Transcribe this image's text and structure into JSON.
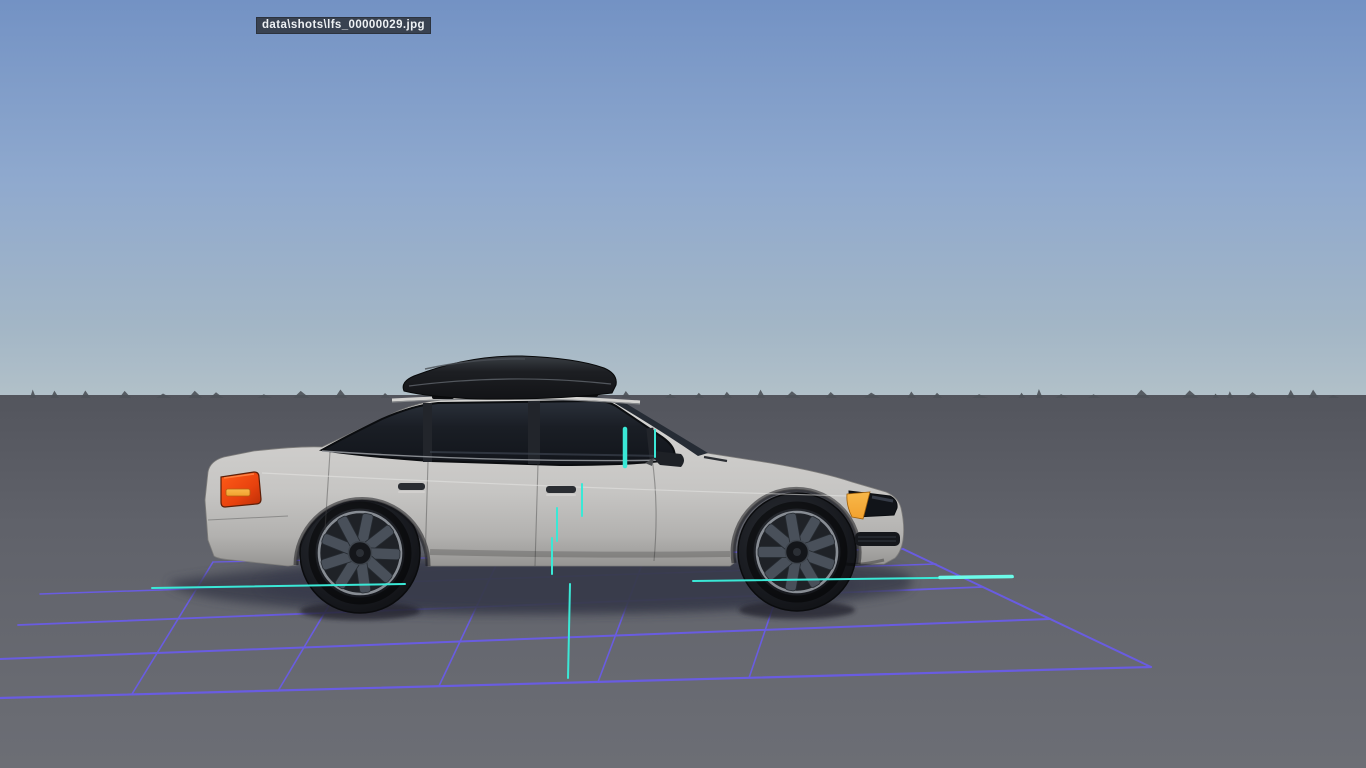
{
  "window": {
    "screenshot_label": "data\\shots\\lfs_00000029.jpg"
  },
  "scene": {
    "description": "3D side view of a light grey sedan with black roof box on flat grey ground with debug wireframe grid",
    "colors": {
      "sky_top": "#7392c4",
      "sky_mid": "#8fa9ce",
      "sky_horizon": "#b2c1c9",
      "ground_far": "#53555d",
      "ground_mid": "#60626a",
      "ground_near": "#6c6e75",
      "horizon_objects": "#4d5158",
      "grid_line": "#6a5ce8",
      "debug_line": "#3ae8d6",
      "debug_line_bright": "#6cfbe9",
      "car_body": "#c6c5c3",
      "car_body_light": "#d8d7d5",
      "car_body_dark": "#8f8e8c",
      "car_glass": "#1a1e25",
      "roof_box": "#121316",
      "tire": "#17191e",
      "rim_spoke": "#49505a",
      "rim_lip": "#888d94",
      "taillight": "#e8420e",
      "indicator": "#f2a12e",
      "headlight_lens": "#111419",
      "car_shadow": "#3a3d4b",
      "label_bg": "#394251",
      "label_text": "#eef1f4"
    }
  }
}
